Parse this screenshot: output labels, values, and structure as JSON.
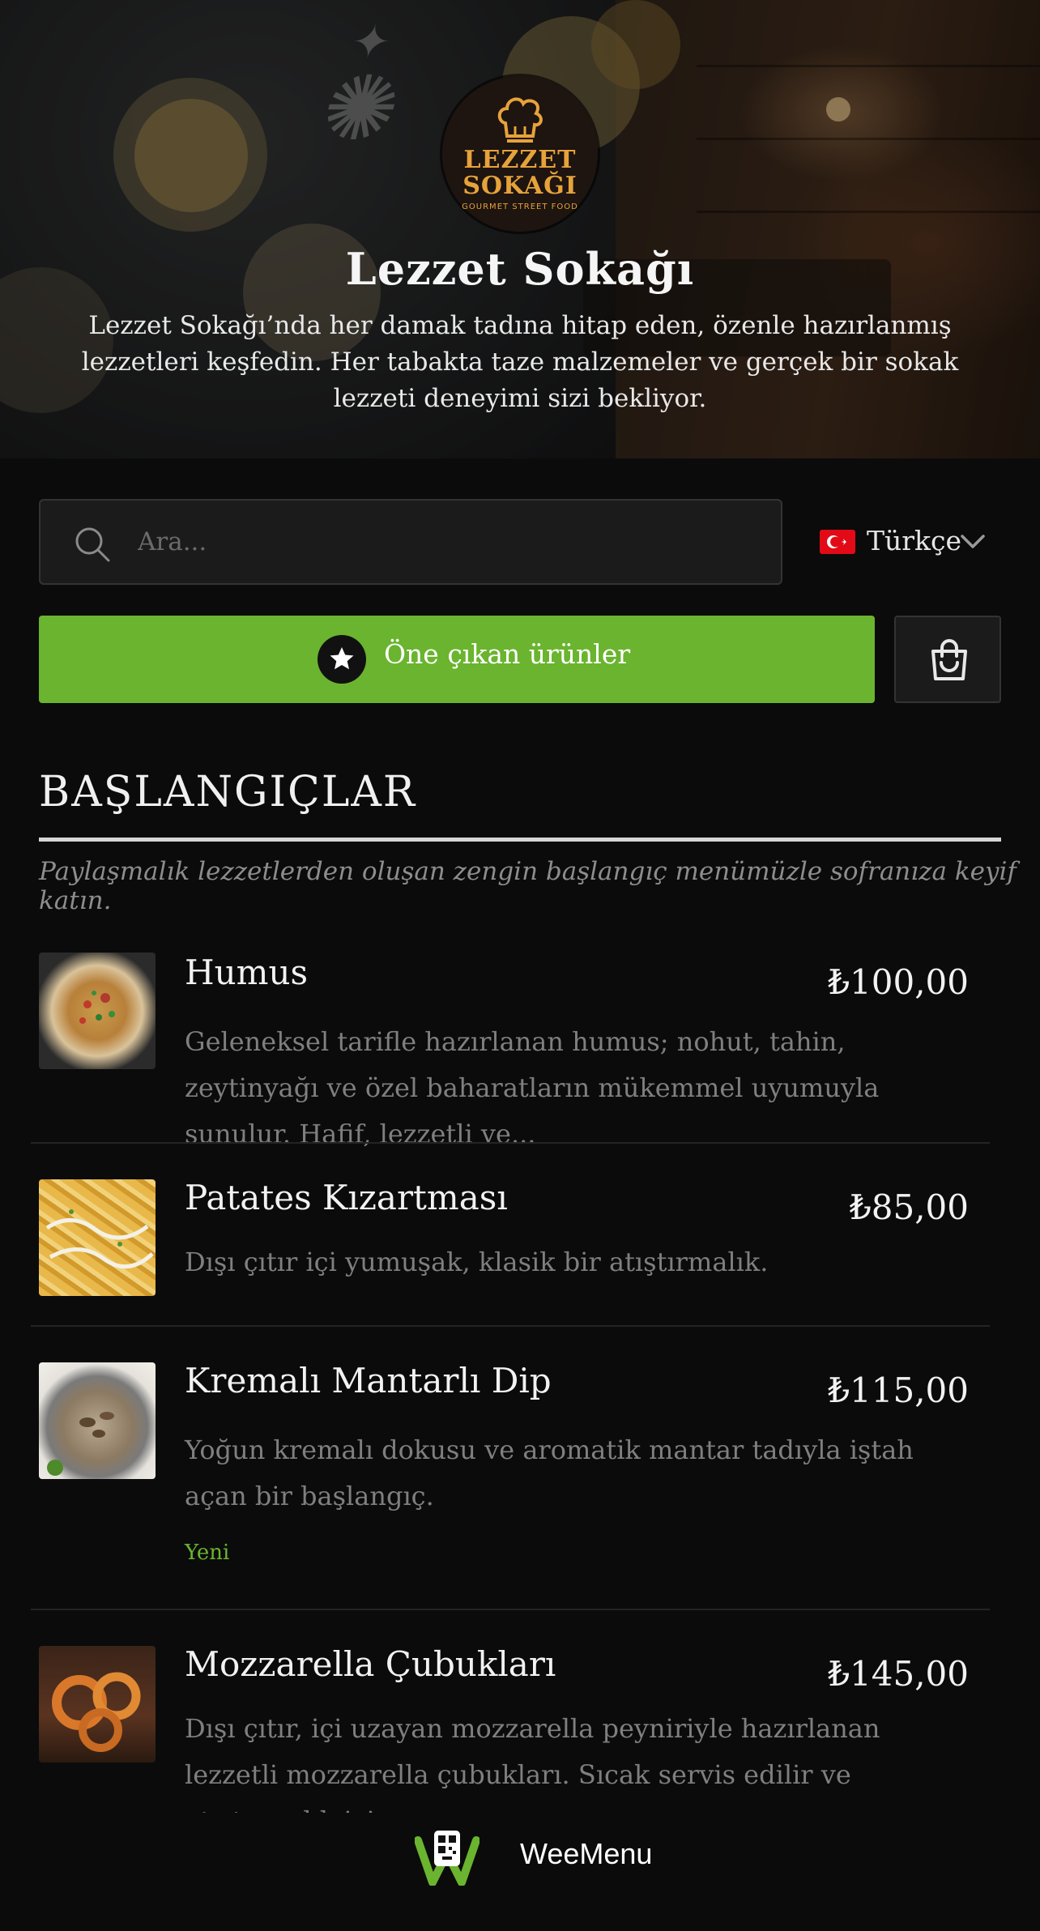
{
  "hero": {
    "title": "Lezzet Sokağı",
    "description": "Lezzet Sokağı’nda her damak tadına hitap eden, özenle hazırlanmış lezzetleri keşfedin. Her tabakta taze malzemeler ve gerçek bir sokak lezzeti deneyimi sizi bekliyor.",
    "logo": {
      "line1": "LEZZET",
      "line2": "SOKAĞI",
      "tagline": "GOURMET STREET FOOD"
    }
  },
  "search": {
    "placeholder": "Ara..."
  },
  "language": {
    "label": "Türkçe"
  },
  "featured": {
    "label": "Öne çıkan ürünler"
  },
  "section": {
    "title": "BAŞLANGIÇLAR",
    "subtitle": "Paylaşmalık lezzetlerden oluşan zengin başlangıç menümüzle sofranıza keyif katın."
  },
  "items": [
    {
      "name": "Humus",
      "price": "₺100,00",
      "description": "Geleneksel tarifle hazırlanan humus; nohut, tahin, zeytinyağı ve özel baharatların mükemmel uyumuyla sunulur. Hafif, lezzetli ve...",
      "badge": ""
    },
    {
      "name": "Patates Kızartması",
      "price": "₺85,00",
      "description": "Dışı çıtır içi yumuşak, klasik bir atıştırmalık.",
      "badge": ""
    },
    {
      "name": "Kremalı Mantarlı Dip",
      "price": "₺115,00",
      "description": "Yoğun kremalı dokusu ve aromatik mantar tadıyla iştah açan bir başlangıç.",
      "badge": "Yeni"
    },
    {
      "name": "Mozzarella Çubukları",
      "price": "₺145,00",
      "description": "Dışı çıtır, içi uzayan mozzarella peyniriyle hazırlanan lezzetli mozzarella çubukları. Sıcak servis edilir ve atıştırmalık için...",
      "badge": ""
    }
  ],
  "footer": {
    "brand": "WeeMenu"
  },
  "colors": {
    "accent": "#6ab42f",
    "background": "#0b0b0b",
    "logo_gold": "#e6a33a"
  },
  "icons": {
    "search": "search-icon",
    "chevron": "chevron-down-icon",
    "star": "star-icon",
    "cart": "shopping-bag-icon",
    "flag": "turkey-flag-icon"
  }
}
